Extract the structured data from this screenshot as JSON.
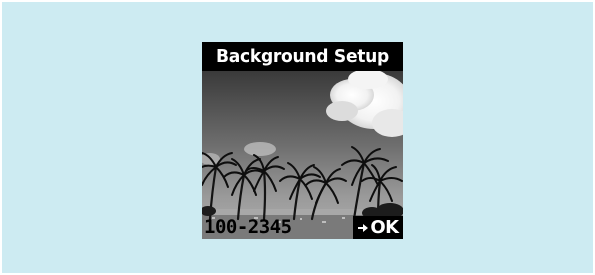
{
  "screen": {
    "title": "Background Setup",
    "code": "100-2345",
    "ok_label": "OK",
    "ok_icon": "arrow-right-icon",
    "image_subject": "palm-trees-photo"
  },
  "colors": {
    "panel_background": "#cdebf2",
    "lcd_background": "#000000",
    "text_light": "#ffffff",
    "text_dark": "#000000"
  }
}
